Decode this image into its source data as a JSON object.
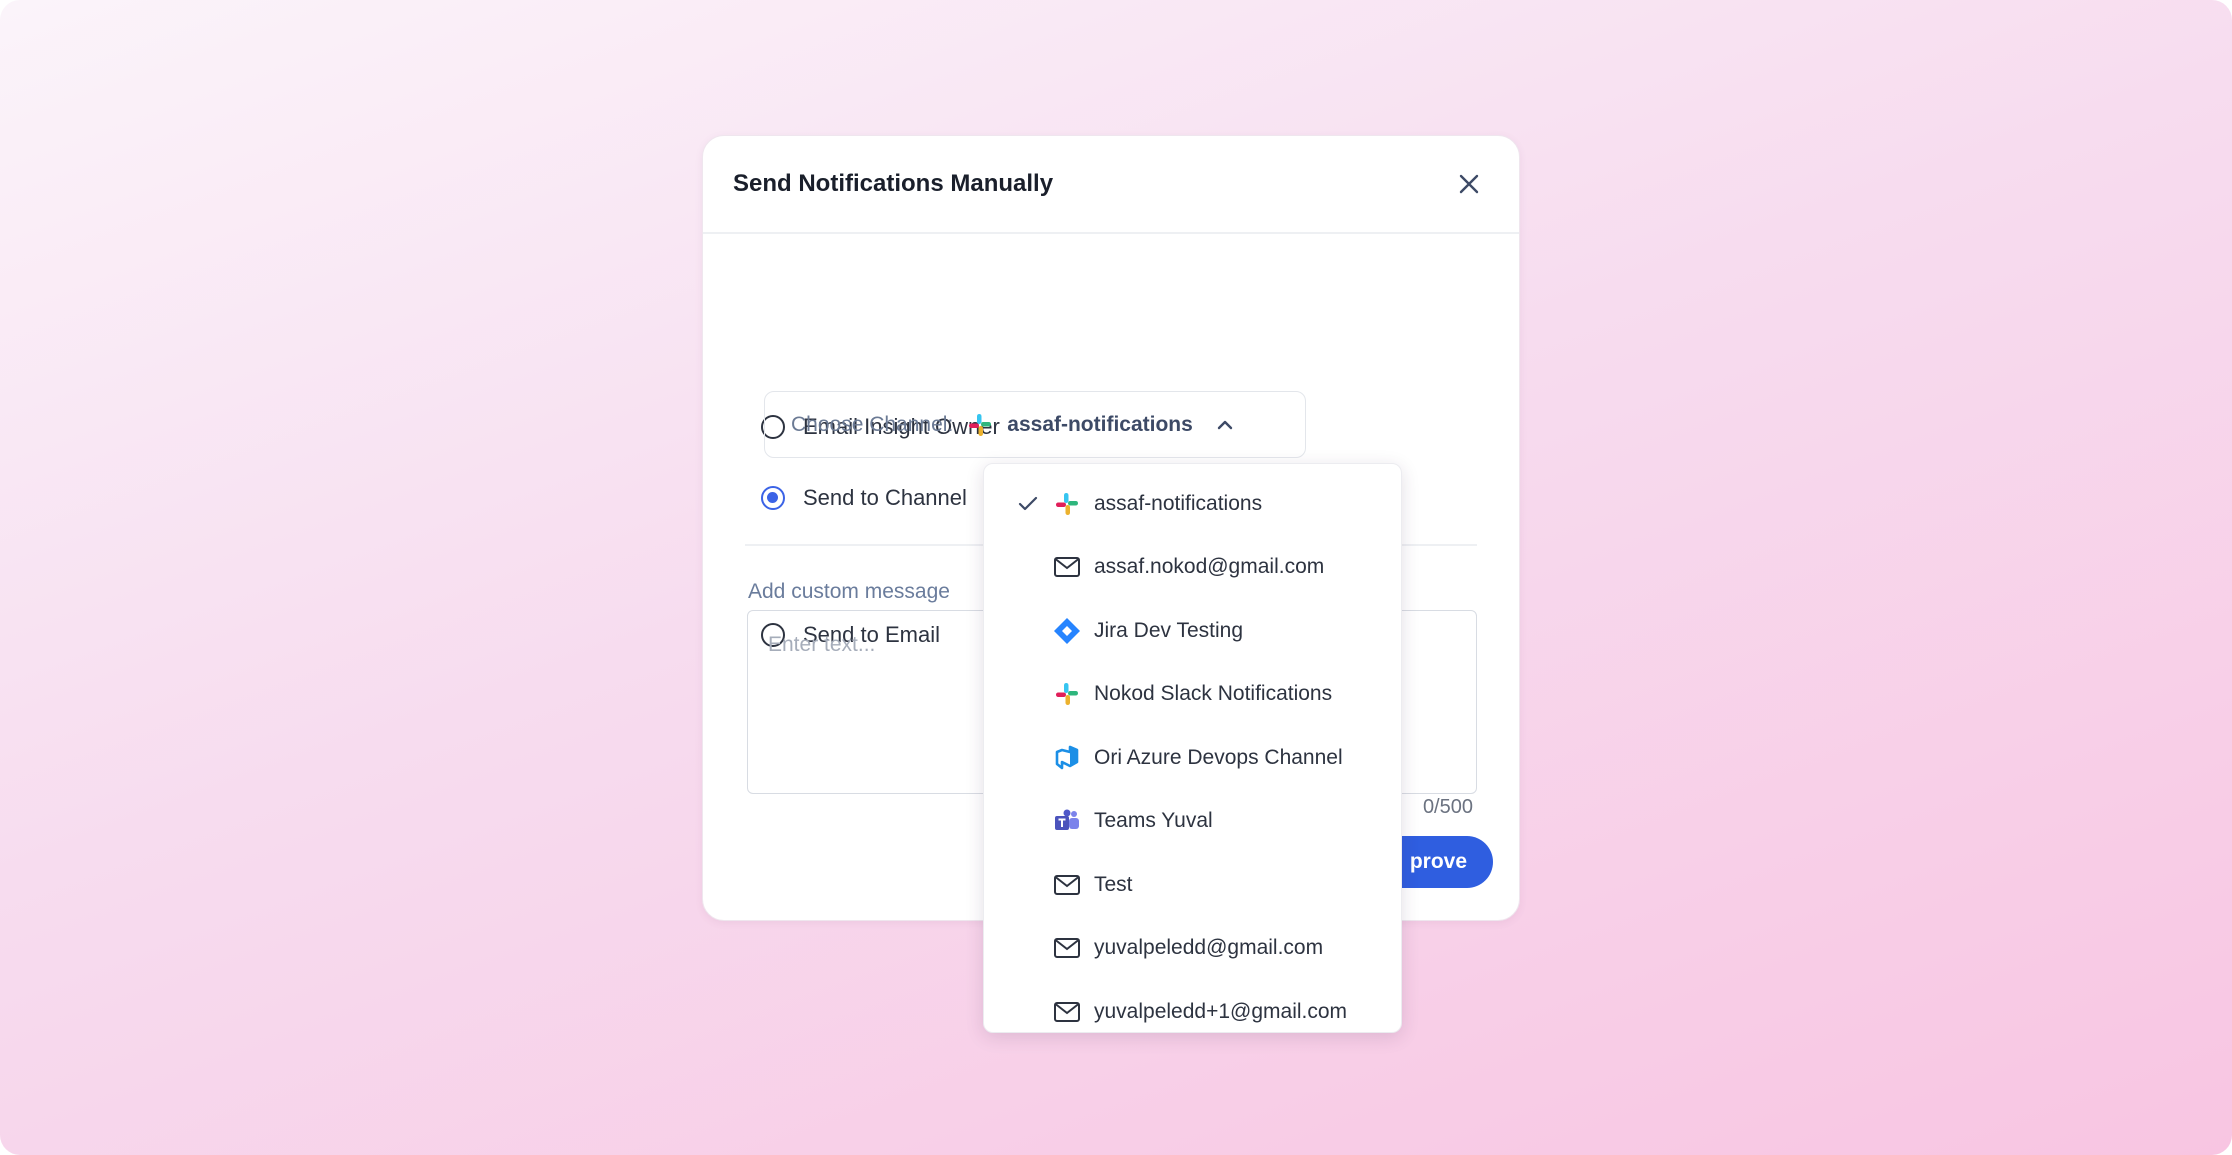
{
  "modal": {
    "title": "Send Notifications Manually",
    "options": [
      {
        "label": "Email Insight Owner",
        "checked": false
      },
      {
        "label": "Send to Channel",
        "checked": true
      },
      {
        "label": "Send to Email",
        "checked": false
      }
    ],
    "channel_select": {
      "label": "Choose Channel:",
      "value": "assaf-notifications",
      "icon": "slack-icon",
      "expanded": true
    },
    "custom_message": {
      "label": "Add custom message",
      "placeholder": "Enter text...",
      "counter": "0/500"
    },
    "approve_label": "Approve",
    "approve_visible_label": "prove"
  },
  "dropdown": {
    "items": [
      {
        "label": "assaf-notifications",
        "icon": "slack-icon",
        "selected": true
      },
      {
        "label": "assaf.nokod@gmail.com",
        "icon": "mail-icon",
        "selected": false
      },
      {
        "label": "Jira Dev Testing",
        "icon": "jira-icon",
        "selected": false
      },
      {
        "label": "Nokod Slack Notifications",
        "icon": "slack-icon",
        "selected": false
      },
      {
        "label": "Ori Azure Devops Channel",
        "icon": "azure-devops-icon",
        "selected": false
      },
      {
        "label": "Teams Yuval",
        "icon": "teams-icon",
        "selected": false
      },
      {
        "label": "Test",
        "icon": "mail-icon",
        "selected": false
      },
      {
        "label": "yuvalpeledd@gmail.com",
        "icon": "mail-icon",
        "selected": false
      },
      {
        "label": "yuvalpeledd+1@gmail.com",
        "icon": "mail-icon",
        "selected": false
      }
    ]
  },
  "colors": {
    "accent": "#2f5ee0",
    "radio_checked": "#3b63e6"
  }
}
